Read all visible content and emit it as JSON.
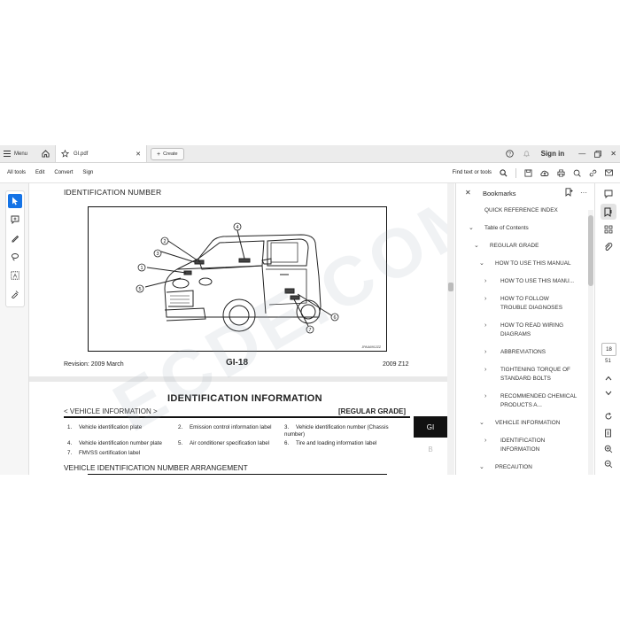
{
  "tabbar": {
    "menu_label": "Menu",
    "doc_tab_title": "GI.pdf",
    "create_label": "Create",
    "sign_in": "Sign in"
  },
  "toolbar": {
    "all_tools": "All tools",
    "edit": "Edit",
    "convert": "Convert",
    "sign": "Sign",
    "find": "Find text or tools"
  },
  "page1": {
    "heading": "IDENTIFICATION NUMBER",
    "revision": "Revision: 2009 March",
    "page_number": "GI-18",
    "model_year": "2009 Z12",
    "figure_code": "JPAIA0912ZZ",
    "callouts": [
      "1",
      "2",
      "3",
      "4",
      "5",
      "6",
      "7"
    ]
  },
  "page2": {
    "heading": "IDENTIFICATION INFORMATION",
    "subheading": "< VEHICLE INFORMATION >",
    "grade": "[REGULAR GRADE]",
    "side_tab_active": "GI",
    "side_tab_next": "B",
    "legend": [
      {
        "n": "1.",
        "t": "Vehicle identification plate"
      },
      {
        "n": "2.",
        "t": "Emission control information label"
      },
      {
        "n": "3.",
        "t": "Vehicle identification number (Chassis number)"
      },
      {
        "n": "4.",
        "t": "Vehicle identification number plate"
      },
      {
        "n": "5.",
        "t": "Air conditioner specification label"
      },
      {
        "n": "6.",
        "t": "Tire and loading information label"
      },
      {
        "n": "7.",
        "t": "FMVSS certification label"
      }
    ],
    "section_title": "VEHICLE IDENTIFICATION NUMBER ARRANGEMENT"
  },
  "watermark": "ECDE.COM",
  "bookmarks": {
    "title": "Bookmarks",
    "items": [
      {
        "label": "QUICK REFERENCE INDEX"
      },
      {
        "label": "Table of Contents"
      },
      {
        "label": "REGULAR GRADE"
      },
      {
        "label": "HOW TO USE THIS MANUAL"
      },
      {
        "label": "HOW TO USE THIS MANU..."
      },
      {
        "label": "HOW TO FOLLOW TROUBLE DIAGNOSES"
      },
      {
        "label": "HOW TO READ WIRING DIAGRAMS"
      },
      {
        "label": "ABBREVIATIONS"
      },
      {
        "label": "TIGHTENING TORQUE OF STANDARD BOLTS"
      },
      {
        "label": "RECOMMENDED CHEMICAL PRODUCTS A..."
      },
      {
        "label": "VEHICLE INFORMATION"
      },
      {
        "label": "IDENTIFICATION INFORMATION"
      },
      {
        "label": "PRECAUTION"
      }
    ]
  },
  "pagination": {
    "current": "18",
    "total": "51"
  }
}
